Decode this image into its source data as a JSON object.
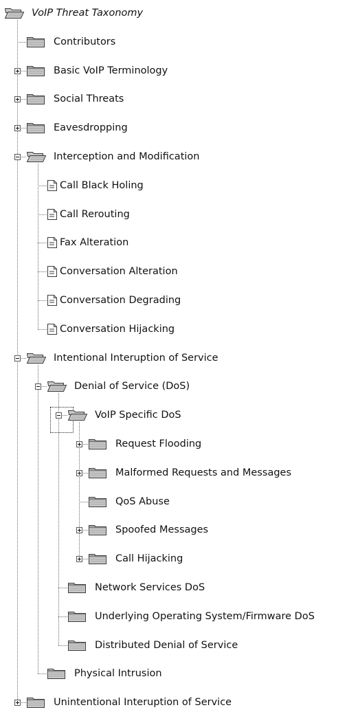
{
  "tree": {
    "nodes": [
      {
        "label": "VoIP Threat Taxonomy",
        "depth": 0,
        "kind": "folder",
        "state": "open",
        "root": true
      },
      {
        "label": "Contributors",
        "depth": 1,
        "kind": "folder",
        "state": "leaf"
      },
      {
        "label": "Basic VoIP Terminology",
        "depth": 1,
        "kind": "folder",
        "state": "collapsed"
      },
      {
        "label": "Social Threats",
        "depth": 1,
        "kind": "folder",
        "state": "collapsed"
      },
      {
        "label": "Eavesdropping",
        "depth": 1,
        "kind": "folder",
        "state": "collapsed"
      },
      {
        "label": "Interception and Modification",
        "depth": 1,
        "kind": "folder",
        "state": "expanded"
      },
      {
        "label": "Call Black Holing",
        "depth": 2,
        "kind": "doc",
        "state": "leaf"
      },
      {
        "label": "Call Rerouting",
        "depth": 2,
        "kind": "doc",
        "state": "leaf"
      },
      {
        "label": "Fax Alteration",
        "depth": 2,
        "kind": "doc",
        "state": "leaf"
      },
      {
        "label": "Conversation Alteration",
        "depth": 2,
        "kind": "doc",
        "state": "leaf"
      },
      {
        "label": "Conversation Degrading",
        "depth": 2,
        "kind": "doc",
        "state": "leaf"
      },
      {
        "label": "Conversation Hijacking",
        "depth": 2,
        "kind": "doc",
        "state": "leaf"
      },
      {
        "label": "Intentional Interuption of Service",
        "depth": 1,
        "kind": "folder",
        "state": "expanded"
      },
      {
        "label": "Denial of Service (DoS)",
        "depth": 2,
        "kind": "folder",
        "state": "expanded"
      },
      {
        "label": "VoIP Specific DoS",
        "depth": 3,
        "kind": "folder",
        "state": "expanded",
        "focused": true
      },
      {
        "label": "Request Flooding",
        "depth": 4,
        "kind": "folder",
        "state": "collapsed"
      },
      {
        "label": "Malformed Requests and Messages",
        "depth": 4,
        "kind": "folder",
        "state": "collapsed"
      },
      {
        "label": "QoS Abuse",
        "depth": 4,
        "kind": "folder",
        "state": "leaf"
      },
      {
        "label": "Spoofed Messages",
        "depth": 4,
        "kind": "folder",
        "state": "collapsed"
      },
      {
        "label": "Call Hijacking",
        "depth": 4,
        "kind": "folder",
        "state": "collapsed"
      },
      {
        "label": "Network Services DoS",
        "depth": 3,
        "kind": "folder",
        "state": "leaf"
      },
      {
        "label": "Underlying Operating System/Firmware DoS",
        "depth": 3,
        "kind": "folder",
        "state": "leaf"
      },
      {
        "label": "Distributed Denial of Service",
        "depth": 3,
        "kind": "folder",
        "state": "leaf"
      },
      {
        "label": "Physical Intrusion",
        "depth": 2,
        "kind": "folder",
        "state": "leaf"
      },
      {
        "label": "Unintentional Interuption of Service",
        "depth": 1,
        "kind": "folder",
        "state": "collapsed"
      }
    ]
  },
  "colors": {
    "folder_body": "#c8c8c8",
    "folder_edge": "#3a3a3a",
    "folder_stripe": "#a8a8a8",
    "doc_body": "#ffffff",
    "connector": "#6a6a6a"
  },
  "icons": {
    "folder": "folder-icon",
    "folder_open": "folder-open-icon",
    "document": "document-icon",
    "expand": "plus-box-icon",
    "collapse": "minus-box-icon"
  }
}
